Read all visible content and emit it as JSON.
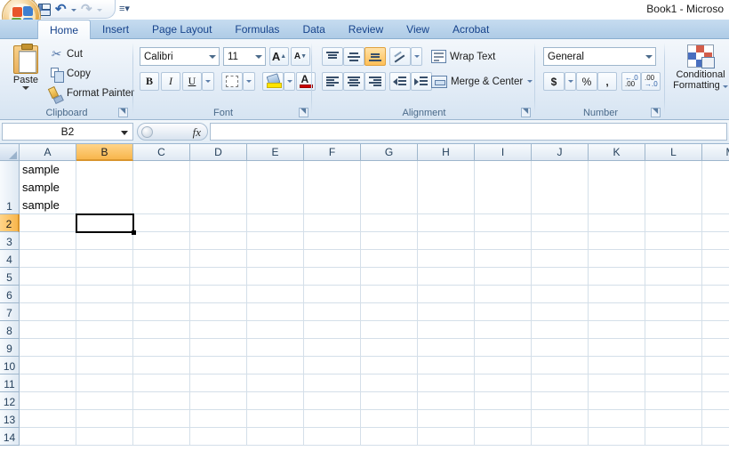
{
  "window": {
    "title": "Book1 - Microso"
  },
  "quick_access": {
    "save_label": "Save",
    "undo_label": "Undo",
    "redo_label": "Redo",
    "customize_label": "Customize Quick Access Toolbar"
  },
  "office_button": {
    "label": "Office Button"
  },
  "ribbon": {
    "tabs": [
      {
        "label": "Home",
        "active": true
      },
      {
        "label": "Insert",
        "active": false
      },
      {
        "label": "Page Layout",
        "active": false
      },
      {
        "label": "Formulas",
        "active": false
      },
      {
        "label": "Data",
        "active": false
      },
      {
        "label": "Review",
        "active": false
      },
      {
        "label": "View",
        "active": false
      },
      {
        "label": "Acrobat",
        "active": false
      }
    ],
    "groups": {
      "clipboard": {
        "label": "Clipboard",
        "paste": "Paste",
        "cut": "Cut",
        "copy": "Copy",
        "format_painter": "Format Painter"
      },
      "font": {
        "label": "Font",
        "font_name": "Calibri",
        "font_size": "11",
        "grow_font": "A",
        "shrink_font": "A",
        "bold": "B",
        "italic": "I",
        "underline": "U"
      },
      "alignment": {
        "label": "Alignment",
        "wrap_text": "Wrap Text",
        "merge_center": "Merge & Center"
      },
      "number": {
        "label": "Number",
        "format": "General",
        "currency": "$",
        "percent": "%",
        "comma": ",",
        "increase_decimal": ".00",
        "decrease_decimal": ".00"
      },
      "styles": {
        "conditional_formatting_line1": "Conditional",
        "conditional_formatting_line2": "Formatting"
      }
    }
  },
  "formula_bar": {
    "name_box": "B2",
    "fx": "fx",
    "formula_value": ""
  },
  "sheet": {
    "columns": [
      "A",
      "B",
      "C",
      "D",
      "E",
      "F",
      "G",
      "H",
      "I",
      "J",
      "K",
      "L",
      "M"
    ],
    "rows": [
      "1",
      "2",
      "3",
      "4",
      "5",
      "6",
      "7",
      "8",
      "9",
      "10",
      "11",
      "12",
      "13",
      "14"
    ],
    "selected_column": "B",
    "selected_row": "2",
    "active_cell": "B2",
    "cells": [
      {
        "ref": "A1",
        "text": "sample\nsample\nsample",
        "lines": [
          "sample",
          "sample",
          "sample"
        ]
      }
    ]
  },
  "colors": {
    "accent": "#f8b64c",
    "tab_text": "#15428b",
    "fill_color": "#ffe400",
    "font_color": "#cc0000",
    "grid_line": "#d4dfe9"
  }
}
